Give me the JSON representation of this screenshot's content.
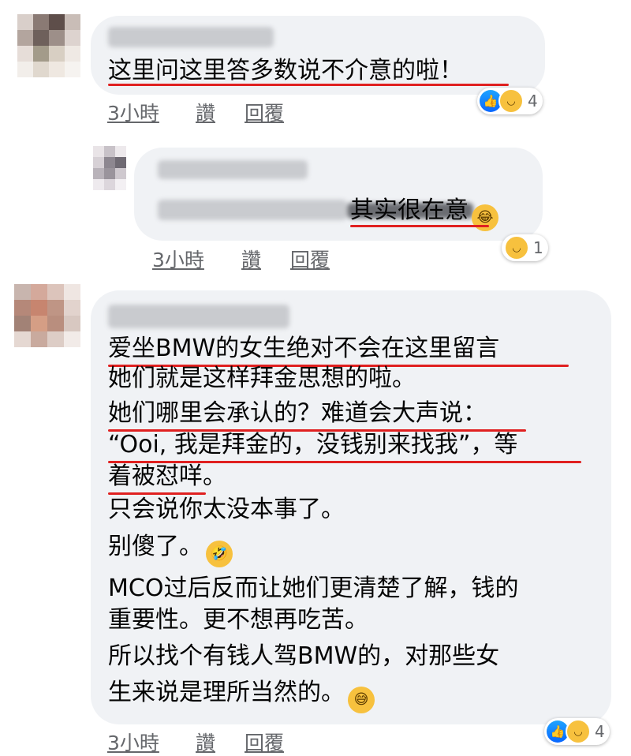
{
  "comments": [
    {
      "lines": [
        "这里问这里答多数说不介意的啦！"
      ],
      "meta": {
        "time": "3小時",
        "like": "讚",
        "reply": "回覆"
      },
      "reactions": {
        "count": "4",
        "icons": [
          "like-icon",
          "haha-icon"
        ]
      }
    },
    {
      "text": "其实很在意",
      "inline_emoji": "tears-of-joy-icon",
      "meta": {
        "time": "3小時",
        "like": "讚",
        "reply": "回覆"
      },
      "reactions": {
        "count": "1",
        "icons": [
          "haha-icon"
        ]
      }
    },
    {
      "lines": [
        "爱坐BMW的女生绝对不会在这里留言",
        "她们就是这样拜金思想的啦。",
        "她们哪里会承认的？难道会大声说：",
        "“Ooi, 我是拜金的，没钱别来找我”，等",
        "着被怼咩。",
        "只会说你太没本事了。",
        "别傻了。",
        "MCO过后反而让她们更清楚了解，钱的",
        "重要性。更不想再吃苦。",
        "所以找个有钱人驾BMW的，对那些女",
        "生来说是理所当然的。"
      ],
      "inline_emojis": [
        "rolling-laughing-icon",
        "grinning-sweat-icon"
      ],
      "meta": {
        "time": "3小時",
        "like": "讚",
        "reply": "回覆"
      },
      "reactions": {
        "count": "4",
        "icons": [
          "like-icon",
          "haha-icon"
        ]
      }
    }
  ]
}
